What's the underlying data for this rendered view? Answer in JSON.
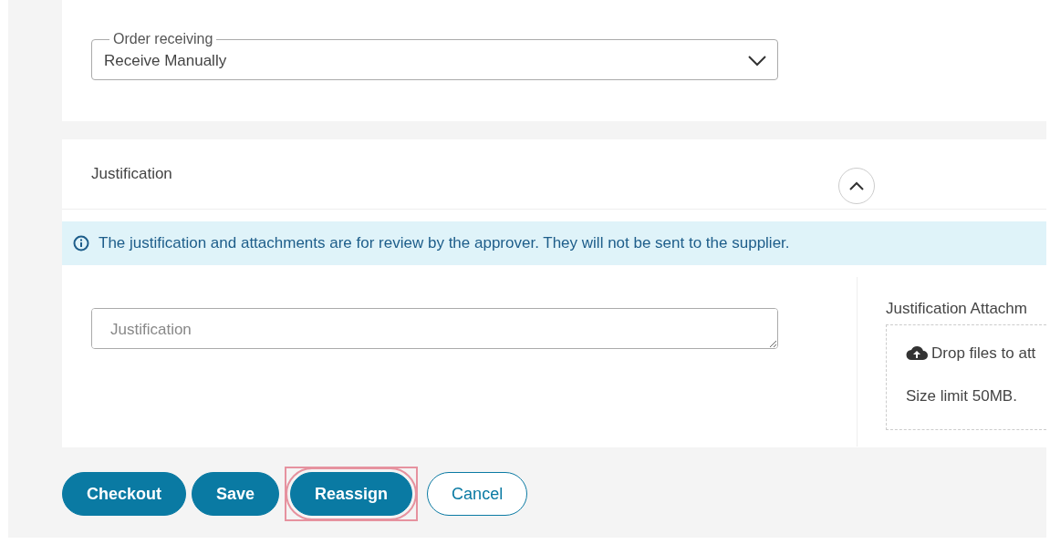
{
  "order_receiving": {
    "label": "Order receiving",
    "value": "Receive Manually"
  },
  "justification_section": {
    "title": "Justification",
    "expanded": true,
    "info": "The justification and attachments are for review by the approver. They will not be sent to the supplier.",
    "justification_field": {
      "placeholder": "Justification"
    },
    "attachments": {
      "label": "Justification Attachm",
      "drop_text": "Drop files to att",
      "size_limit": "Size limit 50MB."
    }
  },
  "buttons": [
    {
      "label": "Checkout",
      "kind": "primary",
      "highlighted": false
    },
    {
      "label": "Save",
      "kind": "primary",
      "highlighted": false
    },
    {
      "label": "Reassign",
      "kind": "primary",
      "highlighted": true
    },
    {
      "label": "Cancel",
      "kind": "outline",
      "highlighted": false
    }
  ]
}
